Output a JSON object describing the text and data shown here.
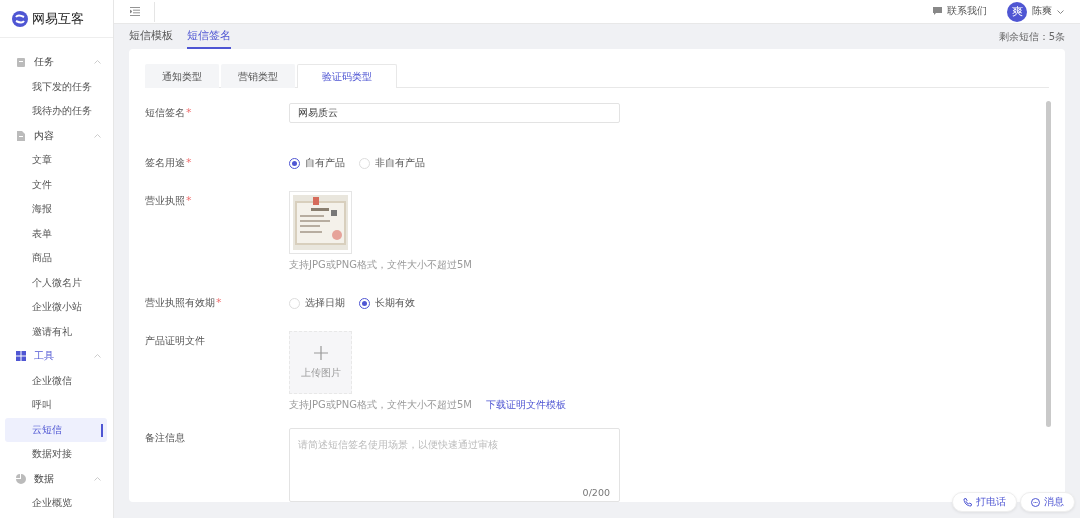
{
  "brand": {
    "name": "网易互客"
  },
  "sidebar": {
    "groups": [
      {
        "label": "任务",
        "expanded": true,
        "selected": false,
        "items": [
          {
            "label": "我下发的任务",
            "selected": false
          },
          {
            "label": "我待办的任务",
            "selected": false
          }
        ]
      },
      {
        "label": "内容",
        "expanded": true,
        "selected": false,
        "items": [
          {
            "label": "文章",
            "selected": false
          },
          {
            "label": "文件",
            "selected": false
          },
          {
            "label": "海报",
            "selected": false
          },
          {
            "label": "表单",
            "selected": false
          },
          {
            "label": "商品",
            "selected": false
          },
          {
            "label": "个人微名片",
            "selected": false
          },
          {
            "label": "企业微小站",
            "selected": false
          },
          {
            "label": "邀请有礼",
            "selected": false
          }
        ]
      },
      {
        "label": "工具",
        "expanded": true,
        "selected": true,
        "items": [
          {
            "label": "企业微信",
            "selected": false
          },
          {
            "label": "呼叫",
            "selected": false
          },
          {
            "label": "云短信",
            "selected": true
          },
          {
            "label": "数据对接",
            "selected": false
          }
        ]
      },
      {
        "label": "数据",
        "expanded": true,
        "selected": false,
        "items": [
          {
            "label": "企业概览",
            "selected": false
          }
        ]
      }
    ]
  },
  "header": {
    "contact": "联系我们",
    "user": {
      "avatar": "爽",
      "name": "陈爽"
    }
  },
  "page_tabs": [
    {
      "label": "短信模板",
      "selected": false
    },
    {
      "label": "短信签名",
      "selected": true
    }
  ],
  "remaining": "剩余短信：5条",
  "type_tabs": [
    {
      "label": "通知类型",
      "selected": false
    },
    {
      "label": "营销类型",
      "selected": false
    },
    {
      "label": "验证码类型",
      "selected": true
    }
  ],
  "form": [
    {
      "kind": "input",
      "label": "短信签名",
      "required_mark": "*",
      "value": "网易质云"
    },
    {
      "kind": "radio",
      "label": "签名用途",
      "required_mark": "*",
      "options": [
        {
          "label": "自有产品",
          "selected": true
        },
        {
          "label": "非自有产品",
          "selected": false
        }
      ]
    },
    {
      "label": "营业执照",
      "required_mark": "*",
      "hint": "支持JPG或PNG格式，文件大小不超过5M"
    },
    {
      "kind": "radio",
      "label": "营业执照有效期",
      "required_mark": "*",
      "options": [
        {
          "label": "选择日期",
          "selected": false
        },
        {
          "label": "长期有效",
          "selected": true
        }
      ]
    },
    {
      "kind": "upload",
      "label": "产品证明文件",
      "upload_text": "上传图片",
      "hint": "支持JPG或PNG格式，文件大小不超过5M",
      "link": "下载证明文件模板"
    },
    {
      "kind": "textarea",
      "label": "备注信息",
      "placeholder": "请简述短信签名使用场景，以便快速通过审核",
      "counter": "0/200"
    }
  ],
  "float_buttons": [
    {
      "label": "打电话"
    },
    {
      "label": "消息"
    }
  ]
}
